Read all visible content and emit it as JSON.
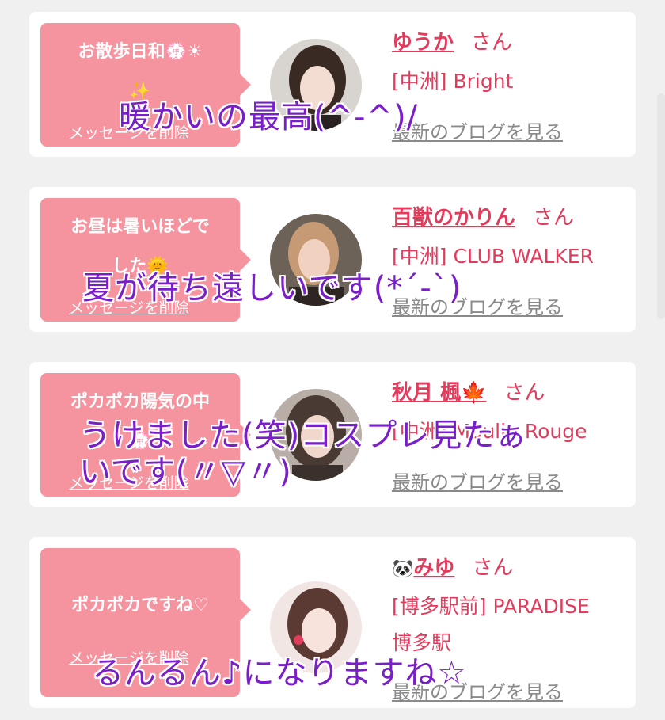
{
  "messages": [
    {
      "bubble_text": "お散歩日和💮☀\n✨",
      "delete_label": "メッセージを削除",
      "name": "ゆうか",
      "suffix": "さん",
      "shop": "[中洲] Bright",
      "blog_link": "最新のブログを見る",
      "avatar_colors": [
        "#d8d4d0",
        "#3a2a24"
      ]
    },
    {
      "bubble_text": "お昼は暑いほどで\nした🌞",
      "delete_label": "メッセージを削除",
      "name": "百獣のかりん",
      "suffix": "さん",
      "shop": "[中洲] CLUB WALKER",
      "blog_link": "最新のブログを見る",
      "avatar_colors": [
        "#6d6258",
        "#c69a74"
      ]
    },
    {
      "bubble_text": "ポカポカ陽気の中\n💮",
      "delete_label": "メッセージを削除",
      "name": "秋月 楓🍁",
      "suffix": "さん",
      "shop": "[中洲] Moulin Rouge",
      "blog_link": "最新のブログを見る",
      "avatar_colors": [
        "#b9aea7",
        "#4a3a34"
      ]
    },
    {
      "bubble_text": "ポカポカですね♡",
      "delete_label": "メッセージを削除",
      "name_icon": "🐼",
      "name": "みゆ",
      "suffix": "さん",
      "shop": "[博多駅前] PARADISE",
      "shop_line2": "博多駅",
      "blog_link": "最新のブログを見る",
      "avatar_colors": [
        "#f1e6e4",
        "#5a3a32"
      ]
    }
  ],
  "overlays": [
    "暖かいの最高(^-^)/",
    "夏が待ち遠しいです(*´-`)",
    "うけました(笑)コスプレ見たぁ",
    "いです(〃▽〃)",
    "るんるん♪になりますね☆"
  ],
  "colors": {
    "bubble": "#f5939f",
    "accent": "#e23b5c",
    "link_gray": "#8a8a8a",
    "overlay_text": "#7a1ec9",
    "background": "#f0f0f0"
  }
}
